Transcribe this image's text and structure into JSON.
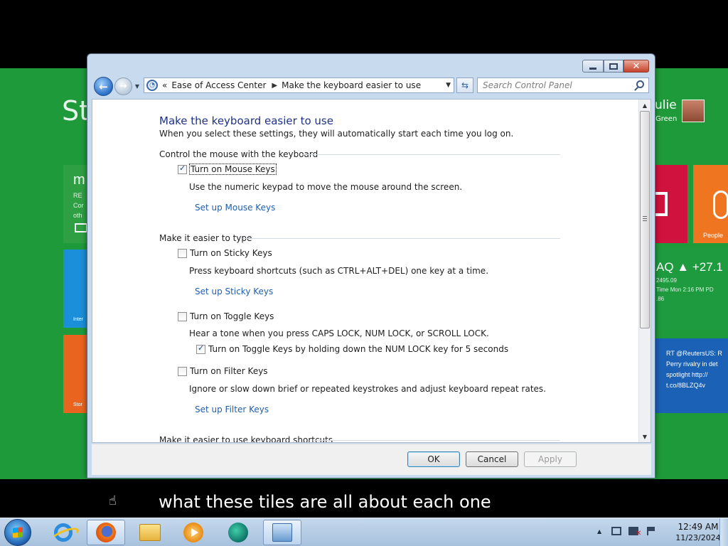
{
  "metro": {
    "start_label": "St",
    "mail_big": "m",
    "mail_small": "RE\nCor\noth",
    "ie_label": "Inter",
    "store_label": "Stor",
    "people_label": "People",
    "stock_ticker": "AQ ▲ +27.1",
    "stock_meta": "2495.09\nTime Mon 2:16 PM PD\n.86",
    "news_text": "RT @ReutersUS: R\nPerry rivalry in det\nspotlight http://\nt.co/8BLZQ4v",
    "user_first": "ulie",
    "user_last": "Green"
  },
  "window": {
    "address": {
      "crumb_root": "«",
      "crumb_1": "Ease of Access Center",
      "crumb_2": "Make the keyboard easier to use",
      "sep": "▶"
    },
    "search_placeholder": "Search Control Panel",
    "page_title": "Make the keyboard easier to use",
    "page_subtitle": "When you select these settings, they will automatically start each time you log on.",
    "groups": [
      {
        "title": "Control the mouse with the keyboard",
        "checkbox_label": "Turn on Mouse Keys",
        "checked": true,
        "description": "Use the numeric keypad to move the mouse around the screen.",
        "link": "Set up Mouse Keys"
      },
      {
        "title": "Make it easier to type"
      },
      {
        "title": "Make it easier to use keyboard shortcuts"
      }
    ],
    "sticky": {
      "checkbox_label": "Turn on Sticky Keys",
      "checked": false,
      "description": "Press keyboard shortcuts (such as CTRL+ALT+DEL) one key at a time.",
      "link": "Set up Sticky Keys"
    },
    "toggle": {
      "checkbox_label": "Turn on Toggle Keys",
      "checked": false,
      "description": "Hear a tone when you press CAPS LOCK, NUM LOCK, or SCROLL LOCK.",
      "sub_checkbox_label": "Turn on Toggle Keys by holding down the NUM LOCK key for 5 seconds",
      "sub_checked": true
    },
    "filter": {
      "checkbox_label": "Turn on Filter Keys",
      "checked": false,
      "description": "Ignore or slow down brief or repeated keystrokes and adjust keyboard repeat rates.",
      "link": "Set up Filter Keys"
    },
    "buttons": {
      "ok": "OK",
      "cancel": "Cancel",
      "apply": "Apply"
    }
  },
  "subtitle": "what these tiles are all about each one",
  "taskbar": {
    "time": "12:49 AM",
    "date": "11/23/2024"
  }
}
